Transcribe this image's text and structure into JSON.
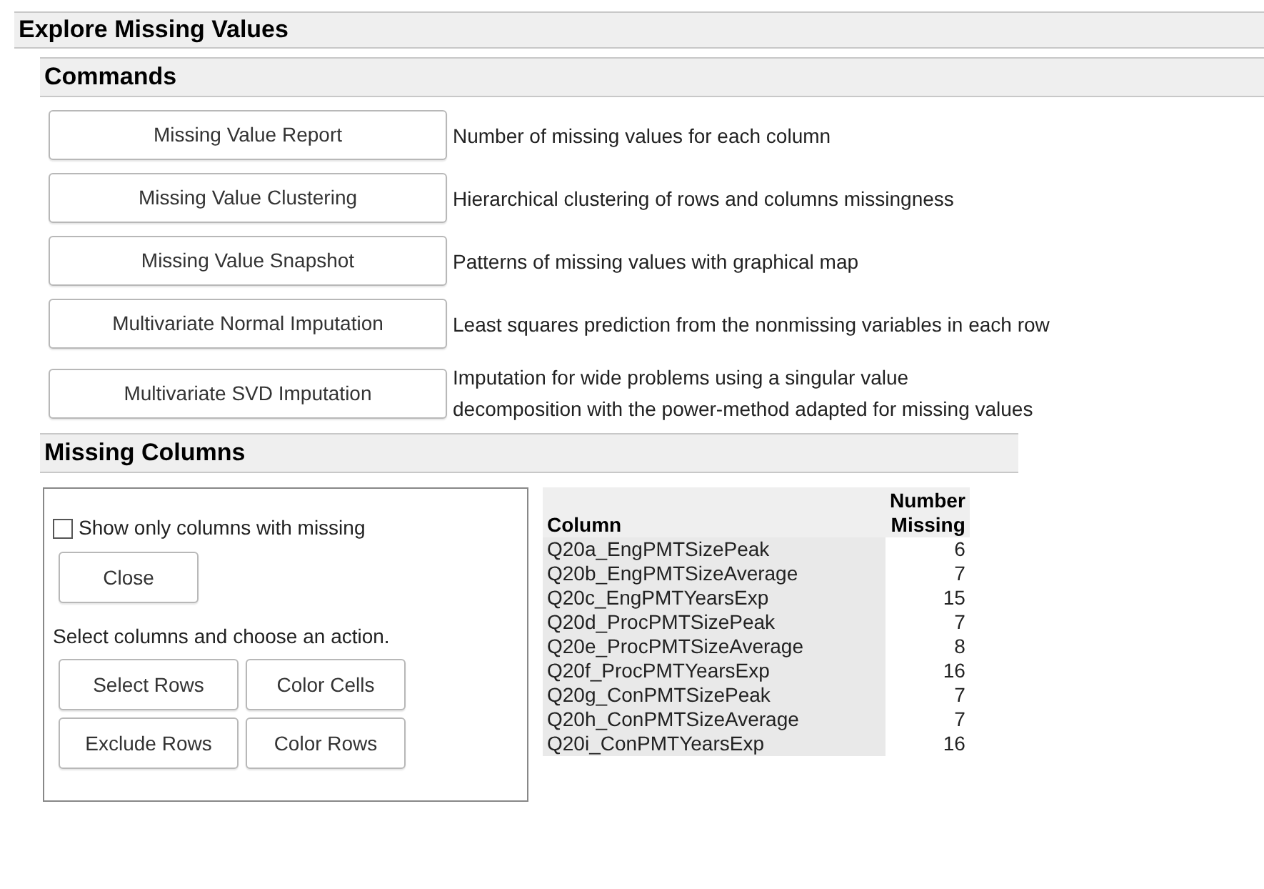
{
  "title": "Explore Missing Values",
  "commands": {
    "title": "Commands",
    "items": [
      {
        "button": "Missing Value Report",
        "description": "Number of missing values for each column"
      },
      {
        "button": "Missing Value Clustering",
        "description": "Hierarchical clustering of rows and columns missingness"
      },
      {
        "button": "Missing Value Snapshot",
        "description": "Patterns of missing values with graphical map"
      },
      {
        "button": "Multivariate Normal Imputation",
        "description": "Least squares prediction from the nonmissing variables in each row"
      },
      {
        "button": "Multivariate SVD Imputation",
        "description": "Imputation for wide problems using a singular value\ndecomposition with the power-method adapted for missing values"
      }
    ]
  },
  "missing_columns": {
    "title": "Missing Columns",
    "show_only_missing": {
      "label": "Show only columns with missing",
      "checked": false
    },
    "close_button": "Close",
    "instruction": "Select columns and choose an action.",
    "actions": [
      "Select Rows",
      "Color Cells",
      "Exclude Rows",
      "Color Rows"
    ],
    "table": {
      "columns": [
        "Column",
        "Number\nMissing"
      ],
      "rows": [
        [
          "Q20a_EngPMTSizePeak",
          "6"
        ],
        [
          "Q20b_EngPMTSizeAverage",
          "7"
        ],
        [
          "Q20c_EngPMTYearsExp",
          "15"
        ],
        [
          "Q20d_ProcPMTSizePeak",
          "7"
        ],
        [
          "Q20e_ProcPMTSizeAverage",
          "8"
        ],
        [
          "Q20f_ProcPMTYearsExp",
          "16"
        ],
        [
          "Q20g_ConPMTSizePeak",
          "7"
        ],
        [
          "Q20h_ConPMTSizeAverage",
          "7"
        ],
        [
          "Q20i_ConPMTYearsExp",
          "16"
        ]
      ]
    }
  }
}
